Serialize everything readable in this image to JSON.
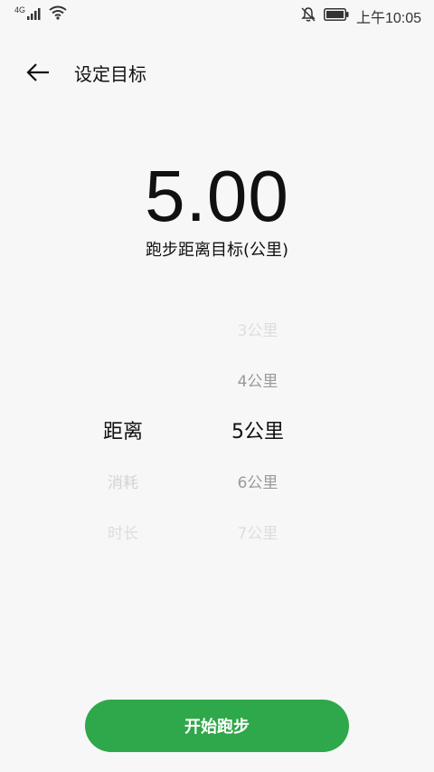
{
  "status_bar": {
    "network": "4G",
    "time": "上午10:05",
    "icons": [
      "signal-icon",
      "wifi-icon",
      "mute-icon",
      "battery-icon"
    ]
  },
  "header": {
    "title": "设定目标",
    "back_icon": "arrow-left-icon"
  },
  "goal": {
    "value": "5.00",
    "caption": "跑步距离目标(公里)"
  },
  "picker": {
    "types": [
      "距离",
      "消耗",
      "时长"
    ],
    "selected_type": "距离",
    "distances": [
      "3公里",
      "4公里",
      "5公里",
      "6公里",
      "7公里"
    ],
    "selected_distance": "5公里"
  },
  "start_button": {
    "label": "开始跑步"
  },
  "colors": {
    "accent": "#2ea84a",
    "background": "#f7f7f7"
  }
}
